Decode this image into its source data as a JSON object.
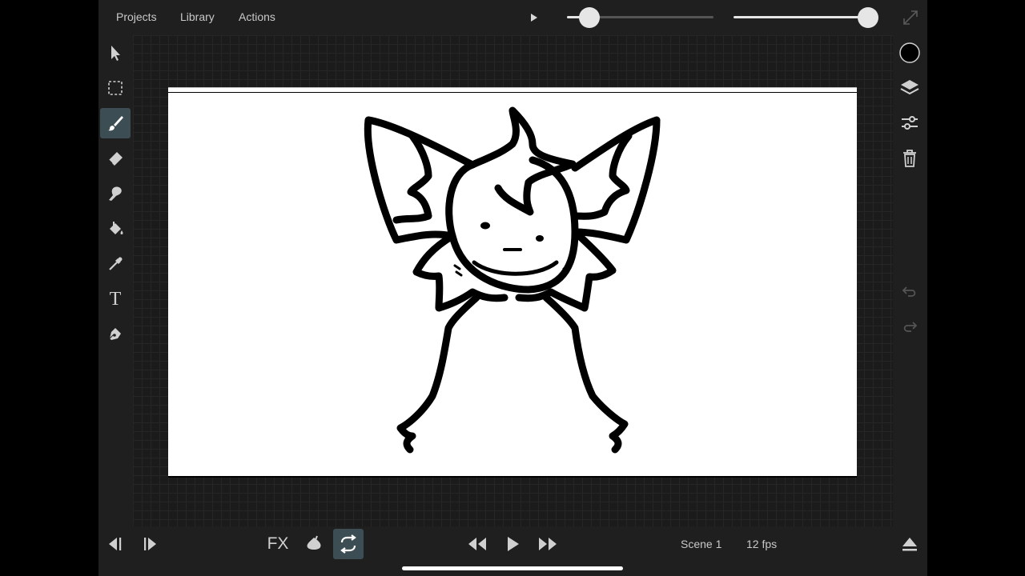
{
  "menu": {
    "projects": "Projects",
    "library": "Library",
    "actions": "Actions"
  },
  "top_sliders": {
    "brush_size": {
      "value": 0.15
    },
    "opacity": {
      "value": 1.0
    }
  },
  "left_tools": [
    {
      "name": "select-icon",
      "active": false
    },
    {
      "name": "marquee-icon",
      "active": false
    },
    {
      "name": "brush-icon",
      "active": true
    },
    {
      "name": "eraser-icon",
      "active": false
    },
    {
      "name": "smudge-icon",
      "active": false
    },
    {
      "name": "fill-bucket-icon",
      "active": false
    },
    {
      "name": "eyedropper-icon",
      "active": false
    },
    {
      "name": "text-icon",
      "active": false
    },
    {
      "name": "pen-icon",
      "active": false
    }
  ],
  "text_tool_glyph": "T",
  "right_tools": {
    "color": "#000000"
  },
  "bottom": {
    "fx_label": "FX",
    "scene_label": "Scene 1",
    "fps_label": "12 fps",
    "loop_active": true
  },
  "colors": {
    "background": "#1f1f1f",
    "accent_active": "#3d4d54",
    "text": "#c9c9c9"
  }
}
